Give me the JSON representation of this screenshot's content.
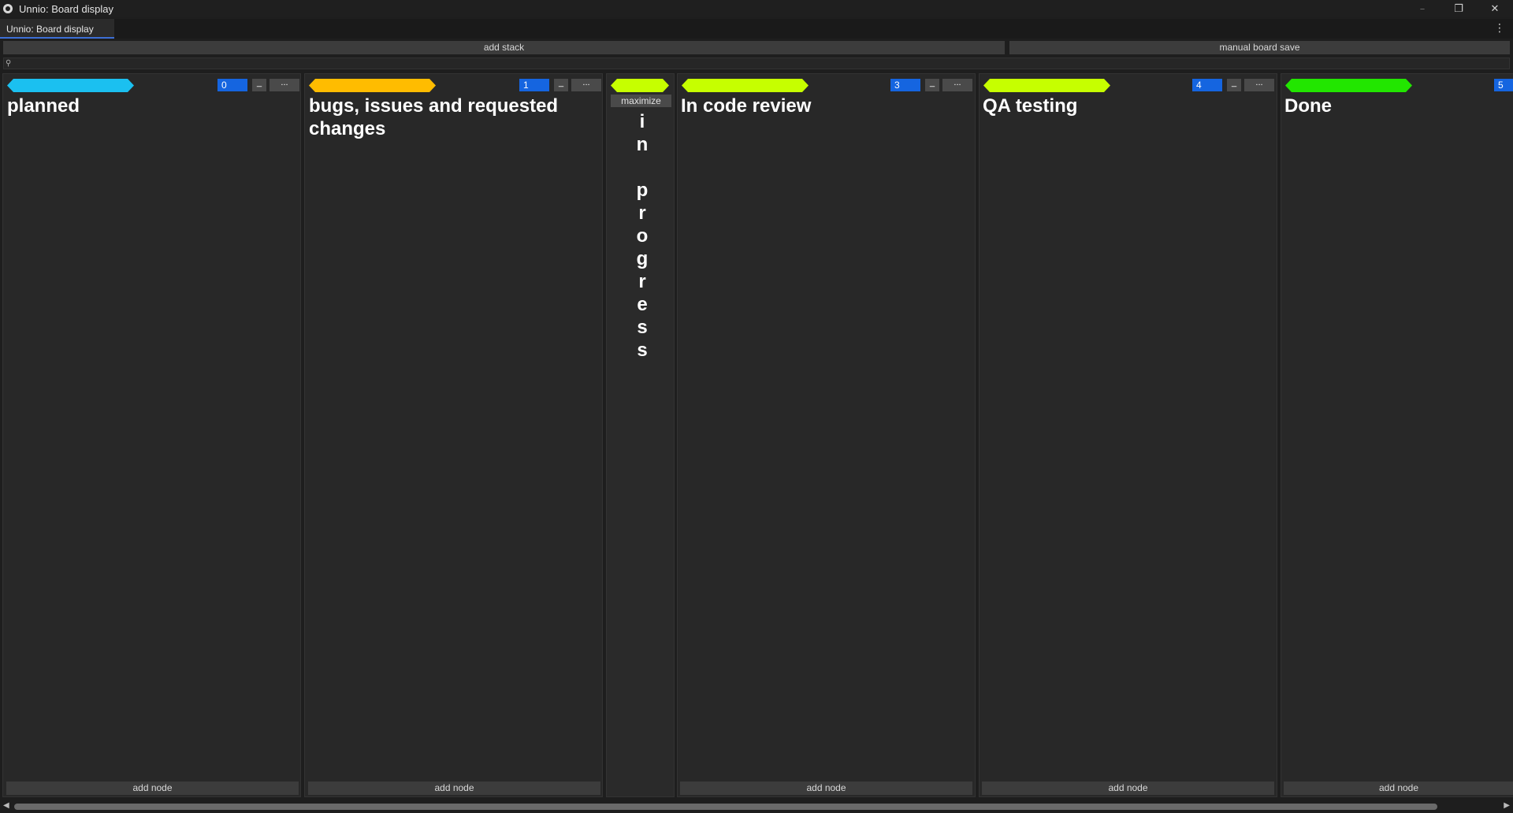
{
  "window": {
    "title": "Unnio: Board display",
    "controls": {
      "minimize": "–",
      "restore": "❐",
      "close": "✕"
    }
  },
  "tabs": [
    {
      "label": "Unnio: Board display",
      "active": true
    }
  ],
  "tab_menu": "⋮",
  "actions": {
    "add_stack": "add stack",
    "manual_save": "manual board save"
  },
  "search": {
    "icon": "search-icon",
    "value": ""
  },
  "stacks": [
    {
      "title": "planned",
      "color": "#1bc0f0",
      "count": "0",
      "minimize": "_",
      "more": "...",
      "add_node": "add node"
    },
    {
      "title": "bugs, issues and requested changes",
      "color": "#ffbc00",
      "count": "1",
      "minimize": "_",
      "more": "...",
      "add_node": "add node"
    },
    {
      "title": "in progress",
      "vertical": "i\nn\n\np\nr\no\ng\nr\ne\ns\ns",
      "color": "#c6ff00",
      "maximize": "maximize",
      "minimized": true
    },
    {
      "title": "In code review",
      "color": "#c6ff00",
      "count": "3",
      "minimize": "_",
      "more": "...",
      "add_node": "add node"
    },
    {
      "title": "QA testing",
      "color": "#c6ff00",
      "count": "4",
      "minimize": "_",
      "more": "...",
      "add_node": "add node"
    },
    {
      "title": "Done",
      "color": "#22e600",
      "count": "5",
      "minimize": "_",
      "more": "...",
      "add_node": "add node"
    }
  ],
  "scrollbar": {
    "left_arrow": "◀",
    "right_arrow": "▶"
  }
}
